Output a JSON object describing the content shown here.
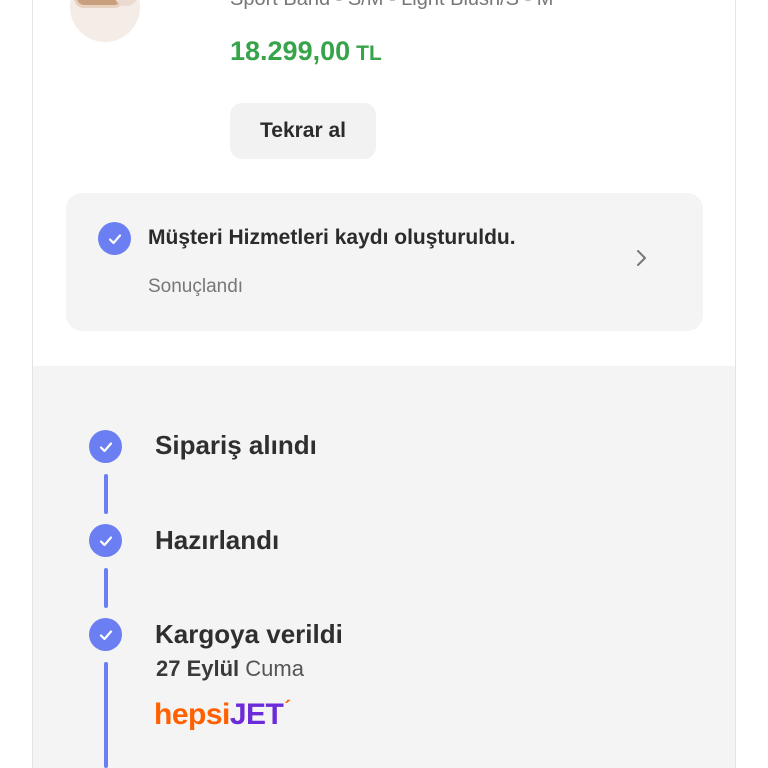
{
  "product": {
    "name": "Sport Band - S/M - Light Blush/S - M",
    "price": "18.299,00",
    "currency": "TL",
    "rebuy_label": "Tekrar al"
  },
  "customer_service": {
    "title": "Müşteri Hizmetleri kaydı oluşturuldu.",
    "status": "Sonuçlandı"
  },
  "timeline": {
    "steps": [
      {
        "label": "Sipariş alındı"
      },
      {
        "label": "Hazırlandı"
      },
      {
        "label": "Kargoya verildi",
        "date_bold": "27 Eylül",
        "date_rest": "Cuma"
      }
    ],
    "carrier": {
      "part1": "hepsi",
      "part2": "JET"
    }
  },
  "colors": {
    "accent": "#6b7ef2",
    "price": "#37a34a",
    "carrier_orange": "#ff6000",
    "carrier_purple": "#6c2bd9"
  },
  "icons": [
    "check-icon",
    "chevron-right-icon"
  ]
}
